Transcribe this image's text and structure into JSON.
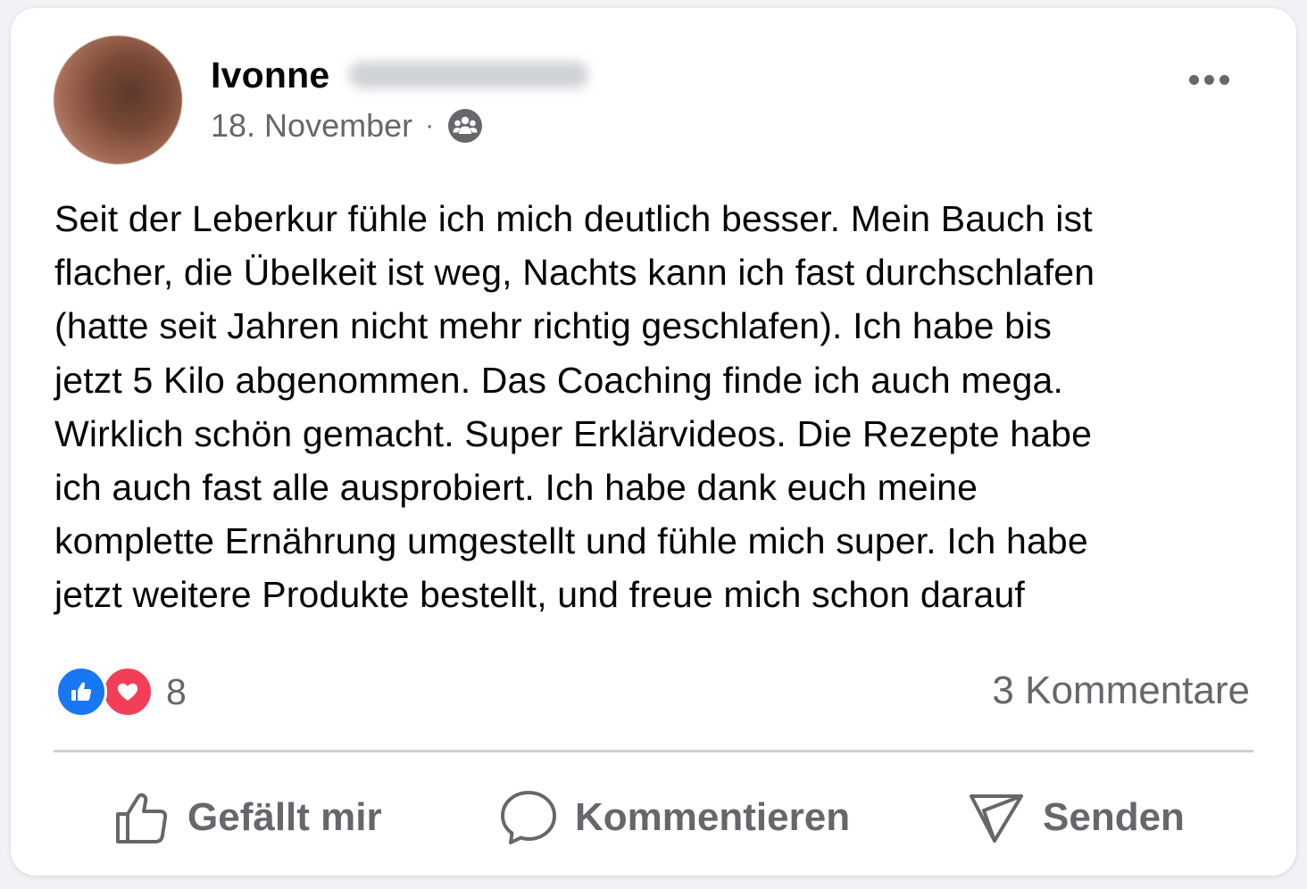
{
  "post": {
    "author_name": "Ivonne",
    "date": "18. November",
    "separator": "·",
    "audience_icon": "group-icon",
    "more_icon": "more-options-icon",
    "text": "Seit der Leberkur fühle ich mich deutlich besser. Mein Bauch ist\nflacher, die Übelkeit ist weg, Nachts kann ich fast durchschlafen\n(hatte seit Jahren nicht mehr richtig geschlafen). Ich habe bis\njetzt 5 Kilo abgenommen. Das Coaching finde ich auch mega.\nWirklich schön gemacht. Super Erklärvideos. Die Rezepte habe\nich auch fast alle ausprobiert. Ich habe dank euch meine\nkomplette Ernährung umgestellt und fühle mich super. Ich habe\njetzt weitere Produkte bestellt, und freue mich schon darauf"
  },
  "stats": {
    "reaction_count": "8",
    "comments": "3 Kommentare",
    "reaction_icons": [
      "like-icon",
      "love-icon"
    ]
  },
  "actions": {
    "like_label": "Gefällt mir",
    "comment_label": "Kommentieren",
    "send_label": "Senden"
  },
  "colors": {
    "like_blue": "#1877f2",
    "love_red": "#f33e58",
    "secondary_text": "#65676b"
  }
}
